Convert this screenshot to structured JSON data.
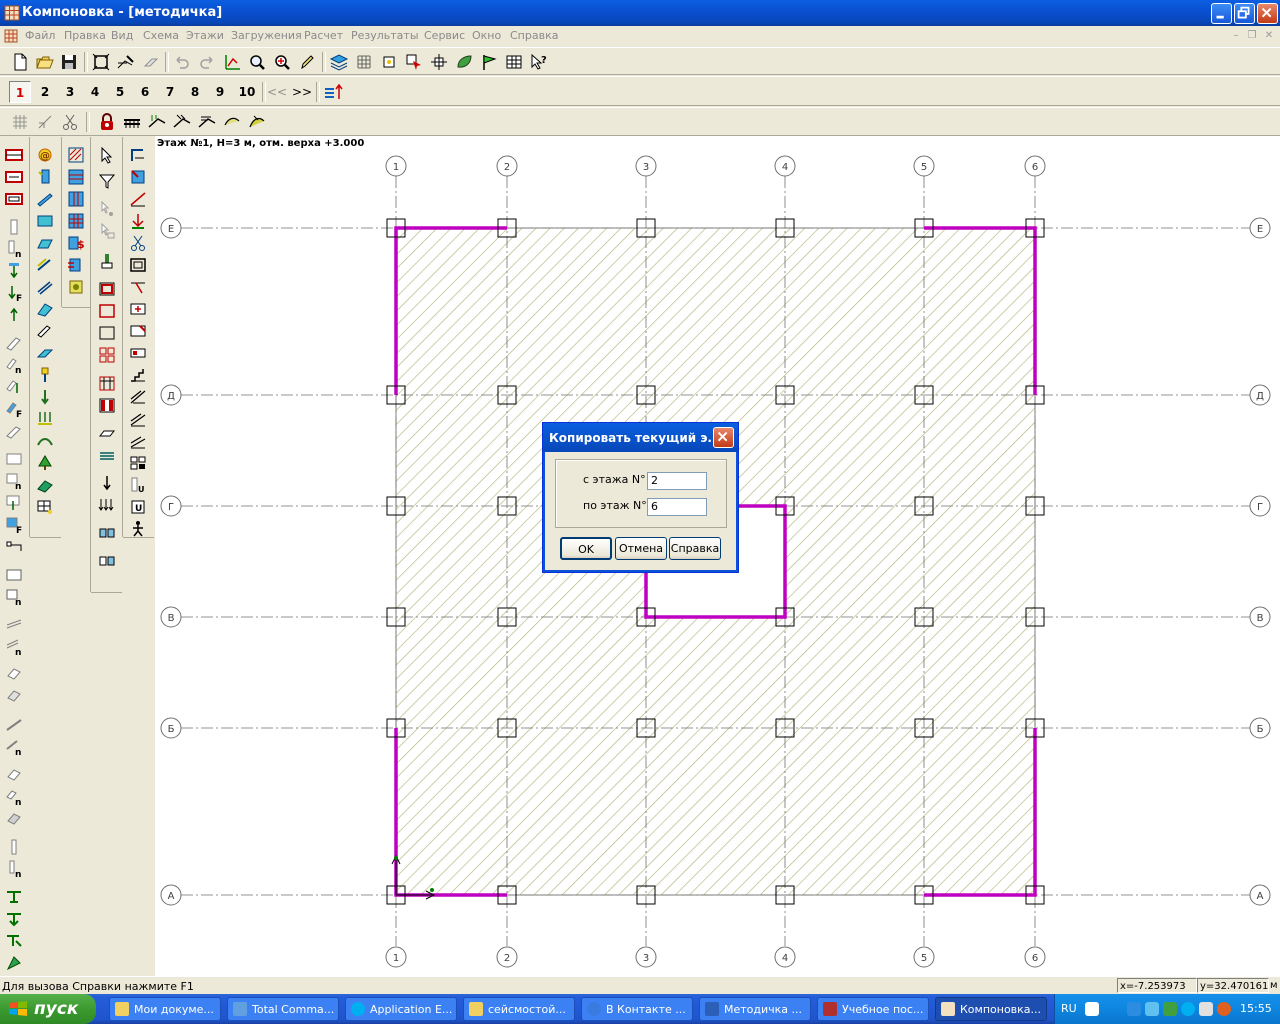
{
  "window": {
    "title": "Компоновка - [методичка]"
  },
  "menu": [
    "Файл",
    "Правка",
    "Вид",
    "Схема",
    "Этажи",
    "Загружения",
    "Расчет",
    "Результаты",
    "Сервис",
    "Окно",
    "Справка"
  ],
  "floor_tabs": {
    "items": [
      "1",
      "2",
      "3",
      "4",
      "5",
      "6",
      "7",
      "8",
      "9",
      "10"
    ],
    "selected": "1",
    "prev": "<<",
    "next": ">>"
  },
  "canvas": {
    "floor_label": "Этаж №1, H=3 м, отм. верха +3.000",
    "column_axes": [
      "1",
      "2",
      "3",
      "4",
      "5",
      "6"
    ],
    "row_axes": [
      "Е",
      "Д",
      "Г",
      "В",
      "Б",
      "А"
    ]
  },
  "dialog": {
    "title": "Копировать текущий э...",
    "from_label": "с этажа N°",
    "from_value": "2",
    "to_label": "по этаж N°",
    "to_value": "6",
    "ok": "OK",
    "cancel": "Отмена",
    "help": "Справка"
  },
  "status": {
    "hint": "Для вызова Справки нажмите F1",
    "x": "x=-7.253973",
    "y": "y=32.470161",
    "unit": "м"
  },
  "taskbar": {
    "start": "пуск",
    "tasks": [
      "Мои докуме...",
      "Total Comma...",
      "Application E...",
      "сейсмостой...",
      "В Контакте ...",
      "Методичка ...",
      "Учебное пос...",
      "Компоновка..."
    ],
    "active": 7,
    "lang": "RU",
    "clock": "15:55"
  },
  "colors": {
    "accent": "#0a4fd0",
    "wall": "#c000c0",
    "hatch": "#b5b37a",
    "selected_floor": "#d40000"
  }
}
